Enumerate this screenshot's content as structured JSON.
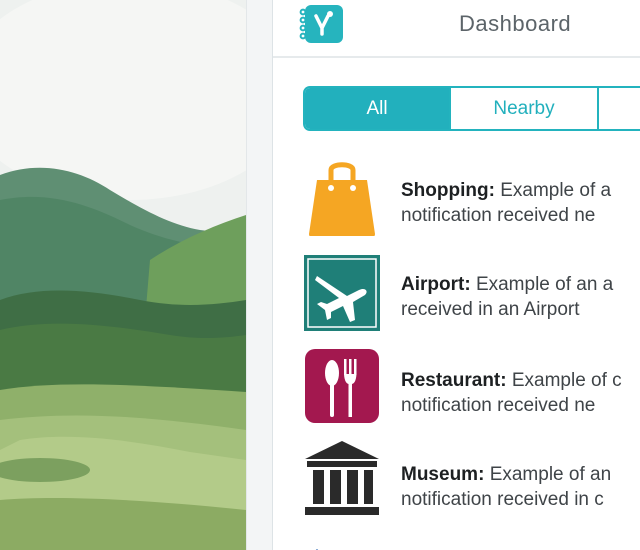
{
  "header": {
    "title": "Dashboard"
  },
  "tabs": [
    {
      "label": "All",
      "active": true
    },
    {
      "label": "Nearby",
      "active": false
    },
    {
      "label": "",
      "active": false
    }
  ],
  "notifications": [
    {
      "icon": "shopping-bag-icon",
      "title": "Shopping:",
      "line1": "Example of a",
      "line2": "notification received ne",
      "color": "#f5a623"
    },
    {
      "icon": "airplane-icon",
      "title": "Airport:",
      "line1": "Example of an a",
      "line2": "received in an Airport",
      "color": "#1f7f78"
    },
    {
      "icon": "fork-spoon-icon",
      "title": "Restaurant:",
      "line1": "Example of c",
      "line2": "notification received ne",
      "color": "#a3184f"
    },
    {
      "icon": "museum-icon",
      "title": "Museum:",
      "line1": "Example of an",
      "line2": "notification received in c",
      "color": "#2a2a2a"
    }
  ],
  "colors": {
    "accent": "#22b0bd",
    "title_text": "#5c6469"
  }
}
